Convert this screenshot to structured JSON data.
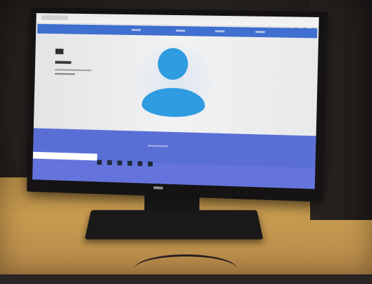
{
  "scene": {
    "description_colors": {
      "navbar": "#3f6fcf",
      "avatar": "#2f9be0",
      "footer": "#5a6fd6",
      "desk": "#c79b4f",
      "bezel": "#151313"
    },
    "icons": [
      "user-avatar-icon"
    ]
  }
}
